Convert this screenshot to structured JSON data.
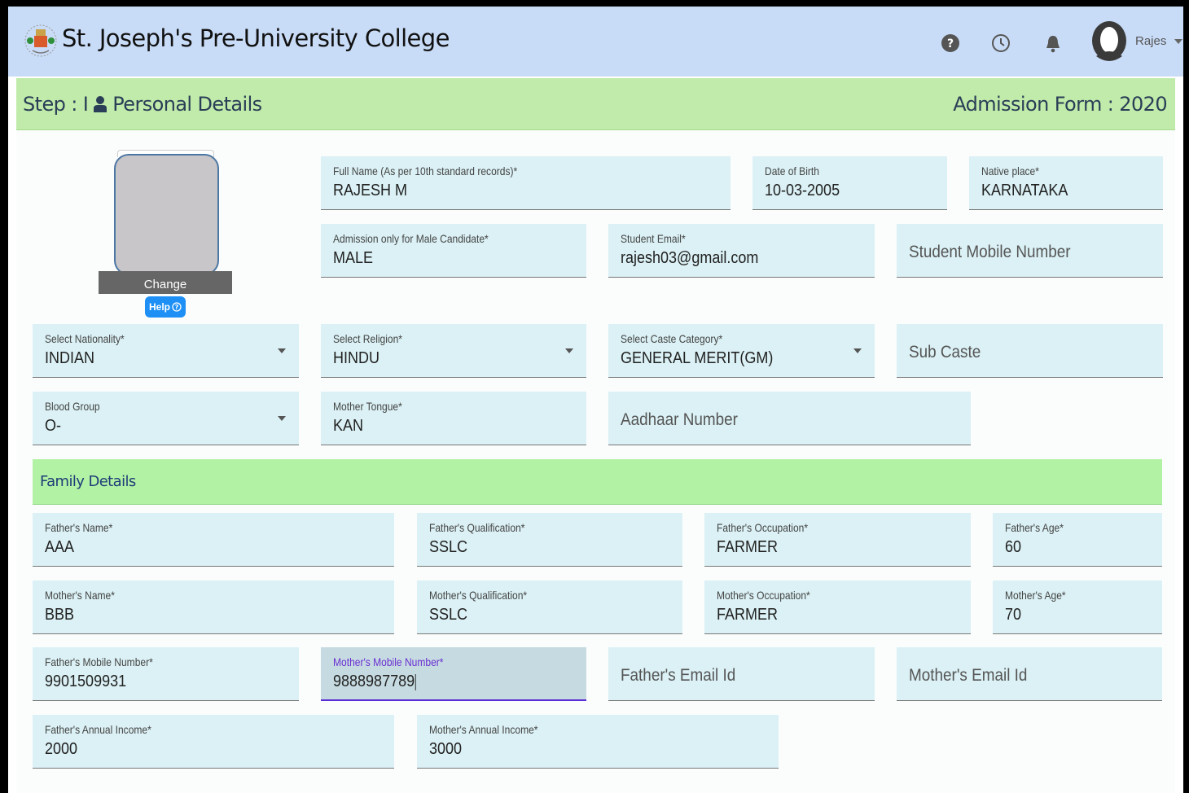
{
  "header": {
    "title": "St. Joseph's Pre-University College",
    "user_name": "Rajes",
    "icons": [
      "help-circle-icon",
      "clock-icon",
      "bell-icon",
      "user-avatar-icon",
      "caret-down-icon"
    ]
  },
  "step": {
    "title": "Step : I",
    "section": "Personal Details",
    "form_title": "Admission Form : 2020"
  },
  "photo": {
    "change_label": "Change",
    "help_label": "Help"
  },
  "personal": {
    "full_name": {
      "label": "Full Name (As per 10th standard records)*",
      "value": "RAJESH M"
    },
    "dob": {
      "label": "Date of Birth",
      "value": "10-03-2005"
    },
    "native_place": {
      "label": "Native place*",
      "value": "KARNATAKA"
    },
    "gender": {
      "label": "Admission only for Male Candidate*",
      "value": "MALE"
    },
    "student_email": {
      "label": "Student Email*",
      "value": "rajesh03@gmail.com"
    },
    "student_mobile": {
      "placeholder": "Student Mobile Number"
    },
    "nationality": {
      "label": "Select Nationality*",
      "value": "INDIAN"
    },
    "religion": {
      "label": "Select Religion*",
      "value": "HINDU"
    },
    "caste_category": {
      "label": "Select Caste Category*",
      "value": "GENERAL MERIT(GM)"
    },
    "sub_caste": {
      "placeholder": "Sub Caste"
    },
    "blood_group": {
      "label": "Blood Group",
      "value": "O-"
    },
    "mother_tongue": {
      "label": "Mother Tongue*",
      "value": "KAN"
    },
    "aadhaar": {
      "placeholder": "Aadhaar Number"
    }
  },
  "family": {
    "heading": "Family Details",
    "father_name": {
      "label": "Father's Name*",
      "value": "AAA"
    },
    "father_qualification": {
      "label": "Father's Qualification*",
      "value": "SSLC"
    },
    "father_occupation": {
      "label": "Father's Occupation*",
      "value": "FARMER"
    },
    "father_age": {
      "label": "Father's Age*",
      "value": "60"
    },
    "mother_name": {
      "label": "Mother's Name*",
      "value": "BBB"
    },
    "mother_qualification": {
      "label": "Mother's Qualification*",
      "value": "SSLC"
    },
    "mother_occupation": {
      "label": "Mother's Occupation*",
      "value": "FARMER"
    },
    "mother_age": {
      "label": "Mother's Age*",
      "value": "70"
    },
    "father_mobile": {
      "label": "Father's Mobile Number*",
      "value": "9901509931"
    },
    "mother_mobile": {
      "label": "Mother's Mobile Number*",
      "value": "9888987789"
    },
    "father_email": {
      "placeholder": "Father's Email Id"
    },
    "mother_email": {
      "placeholder": "Mother's Email Id"
    },
    "father_income": {
      "label": "Father's Annual Income*",
      "value": "2000"
    },
    "mother_income": {
      "label": "Mother's Annual Income*",
      "value": "3000"
    }
  },
  "colors": {
    "topbar": "#c9dcf7",
    "stepbar": "#c1ebaa",
    "field_bg": "#dbf1f5",
    "focus": "#5b2dd4",
    "help_button": "#1e90f5"
  }
}
